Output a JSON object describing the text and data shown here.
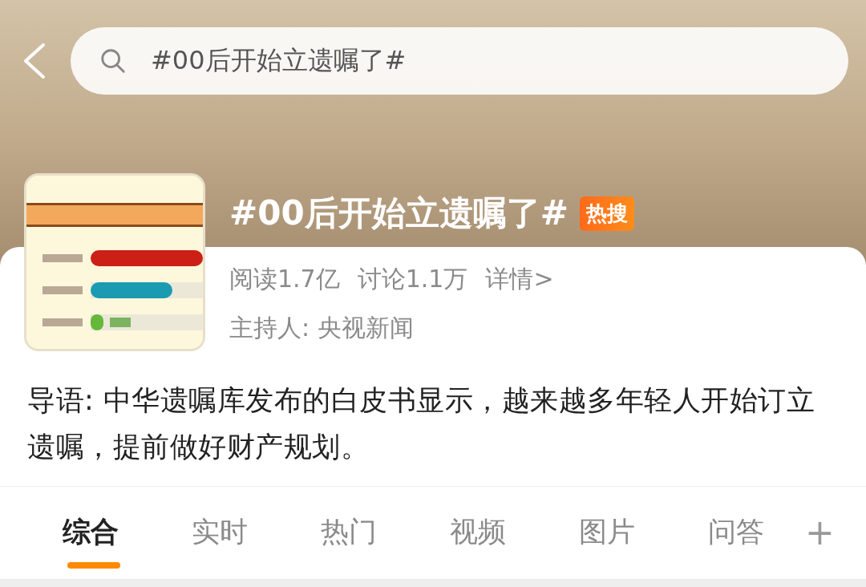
{
  "search": {
    "value": "#00后开始立遗嘱了#"
  },
  "topic": {
    "title": "#00后开始立遗嘱了#",
    "badge": "热搜",
    "stats": [
      "阅读1.7亿",
      "讨论1.1万"
    ],
    "details_link": "详情>",
    "host": "主持人: 央视新闻"
  },
  "intro": "导语: 中华遗嘱库发布的白皮书显示，越来越多年轻人开始订立遗嘱，提前做好财产规划。",
  "tabs": [
    {
      "label": "综合",
      "selected": true
    },
    {
      "label": "实时",
      "selected": false
    },
    {
      "label": "热门",
      "selected": false
    },
    {
      "label": "视频",
      "selected": false
    },
    {
      "label": "图片",
      "selected": false
    },
    {
      "label": "问答",
      "selected": false
    }
  ],
  "add_tab": "+"
}
